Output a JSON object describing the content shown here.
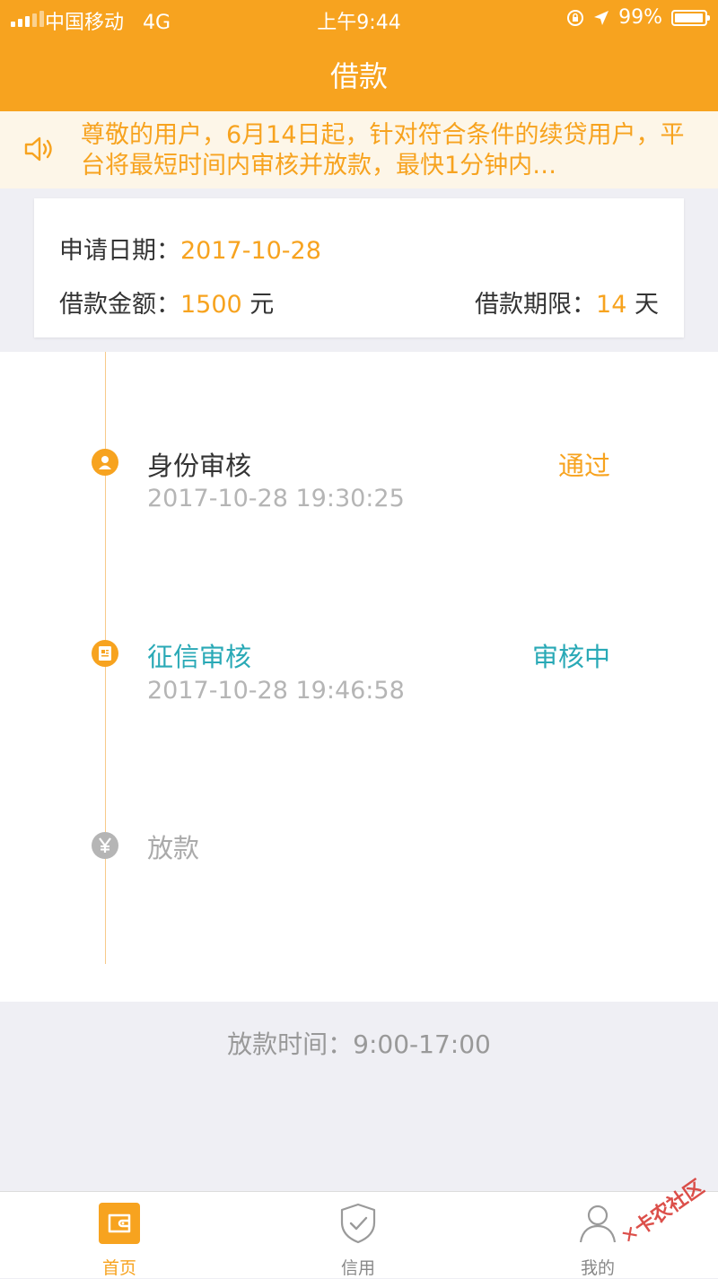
{
  "status_bar": {
    "carrier": "中国移动",
    "network": "4G",
    "time": "上午9:44",
    "battery": "99%"
  },
  "nav": {
    "title": "借款"
  },
  "notice": {
    "text": "尊敬的用户，6月14日起，针对符合条件的续贷用户，平台将最短时间内审核并放款，最快1分钟内…",
    "icon": "speaker-icon"
  },
  "application": {
    "date_label": "申请日期：",
    "date_value": "2017-10-28",
    "amount_label": "借款金额：",
    "amount_value": "1500",
    "amount_unit": " 元",
    "term_label": "借款期限：",
    "term_value": "14",
    "term_unit": " 天"
  },
  "steps": [
    {
      "title": "身份审核",
      "time": "2017-10-28 19:30:25",
      "status": "通过",
      "icon": "user-icon",
      "color": "#f7a31f"
    },
    {
      "title": "征信审核",
      "time": "2017-10-28 19:46:58",
      "status": "审核中",
      "icon": "credit-report-icon",
      "color": "#29a9b6"
    },
    {
      "title": "放款",
      "time": "",
      "status": "",
      "icon": "yen-icon",
      "color": "#b5b5b5"
    }
  ],
  "footer_note": "放款时间：9:00-17:00",
  "tabbar": [
    {
      "label": "首页",
      "icon": "wallet-icon",
      "active": true
    },
    {
      "label": "信用",
      "icon": "shield-check-icon",
      "active": false
    },
    {
      "label": "我的",
      "icon": "person-icon",
      "active": false
    }
  ],
  "watermark": "卡农社区",
  "colors": {
    "primary": "#f7a31f",
    "teal": "#29a9b6",
    "gray": "#b5b5b5"
  }
}
